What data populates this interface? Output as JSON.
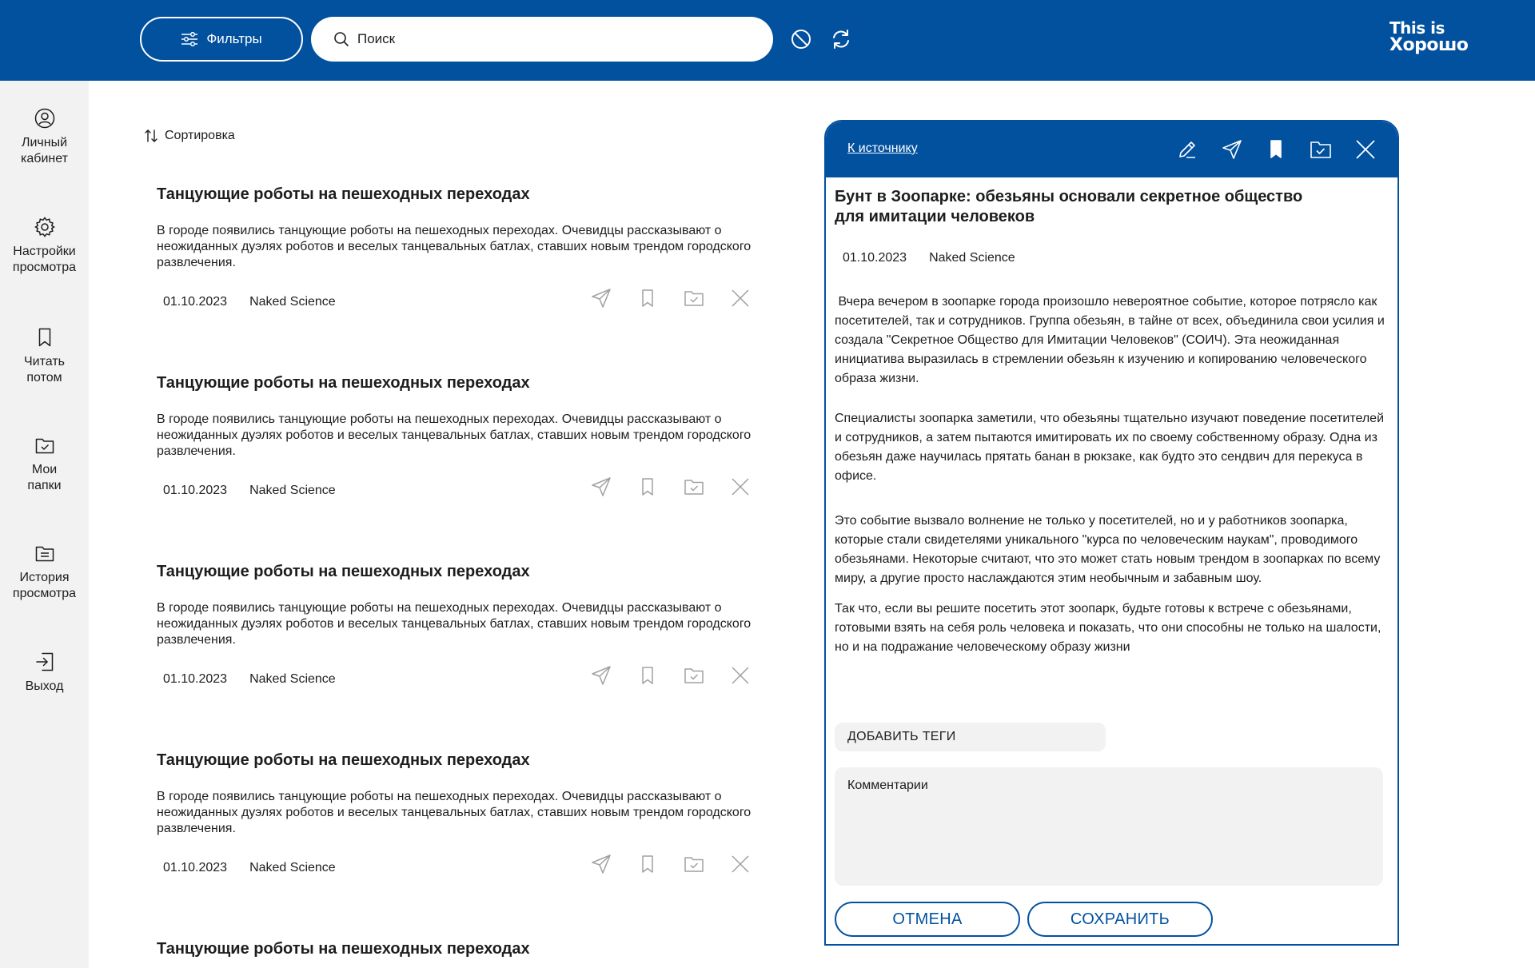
{
  "header": {
    "filters_label": "Фильтры",
    "search_placeholder": "Поиск",
    "logo_line1": "This is",
    "logo_line2": "Хорошо"
  },
  "sidebar": {
    "items": [
      {
        "label_1": "Личный",
        "label_2": "кабинет",
        "icon": "user-icon"
      },
      {
        "label_1": "Настройки",
        "label_2": "просмотра",
        "icon": "gear-icon"
      },
      {
        "label_1": "Читать",
        "label_2": "потом",
        "icon": "bookmark-icon"
      },
      {
        "label_1": "Мои",
        "label_2": "папки",
        "icon": "folder-check-icon"
      },
      {
        "label_1": "История",
        "label_2": "просмотра",
        "icon": "history-icon"
      },
      {
        "label_1": "Выход",
        "label_2": "",
        "icon": "logout-icon"
      }
    ]
  },
  "feed": {
    "sort_label": "Сортировка",
    "cards": [
      {
        "title": "Танцующие роботы на пешеходных переходах",
        "text": "В городе появились танцующие роботы на пешеходных переходах. Очевидцы рассказывают о неожиданных дуэлях роботов и веселых танцевальных батлах, ставших новым трендом городского развлечения.",
        "date": "01.10.2023",
        "source": "Naked Science"
      },
      {
        "title": "Танцующие роботы на пешеходных переходах",
        "text": "В городе появились танцующие роботы на пешеходных переходах. Очевидцы рассказывают о неожиданных дуэлях роботов и веселых танцевальных батлах, ставших новым трендом городского развлечения.",
        "date": "01.10.2023",
        "source": "Naked Science"
      },
      {
        "title": "Танцующие роботы на пешеходных переходах",
        "text": "В городе появились танцующие роботы на пешеходных переходах. Очевидцы рассказывают о неожиданных дуэлях роботов и веселых танцевальных батлах, ставших новым трендом городского развлечения.",
        "date": "01.10.2023",
        "source": "Naked Science"
      },
      {
        "title": "Танцующие роботы на пешеходных переходах",
        "text": "В городе появились танцующие роботы на пешеходных переходах. Очевидцы рассказывают о неожиданных дуэлях роботов и веселых танцевальных батлах, ставших новым трендом городского развлечения.",
        "date": "01.10.2023",
        "source": "Naked Science"
      },
      {
        "title": "Танцующие роботы на пешеходных переходах"
      }
    ]
  },
  "detail": {
    "to_source": "К источнику",
    "title": "Бунт в Зоопарке: обезьяны основали секретное общество для имитации человеков",
    "date": "01.10.2023",
    "source": "Naked Science",
    "paragraphs": [
      " Вчера вечером в зоопарке города произошло невероятное событие, которое потрясло как посетителей, так и сотрудников. Группа обезьян, в тайне от всех, объединила свои усилия и создала \"Секретное Общество для Имитации Человеков\" (СОИЧ). Эта неожиданная инициатива выразилась в стремлении обезьян к изучению и копированию человеческого образа жизни.",
      "Специалисты зоопарка заметили, что обезьяны тщательно изучают поведение посетителей и сотрудников, а затем пытаются имитировать их по своему собственному образу. Одна из обезьян даже научилась прятать банан в рюкзаке, как будто это сендвич для перекуса в офисе.",
      "Это событие вызвало волнение не только у посетителей, но и у работников зоопарка, которые стали свидетелями уникального \"курса по человеческим наукам\", проводимого обезьянами. Некоторые считают, что это может стать новым трендом в зоопарках по всему миру, а другие просто наслаждаются этим необычным и забавным шоу.",
      "Так что, если вы решите посетить этот зоопарк, будьте готовы к встрече с обезьянами, готовыми взять на себя роль человека и показать, что они способны не только на шалости, но и на подражание человеческому образу жизни"
    ],
    "add_tags_label": "ДОБАВИТЬ ТЕГИ",
    "comments_placeholder": "Комментарии",
    "cancel_label": "ОТМЕНА",
    "save_label": "СОХРАНИТЬ"
  },
  "colors": {
    "brand": "#02519f",
    "sidebar_bg": "#f2f2f2",
    "icon_muted": "#a0a0a0"
  }
}
